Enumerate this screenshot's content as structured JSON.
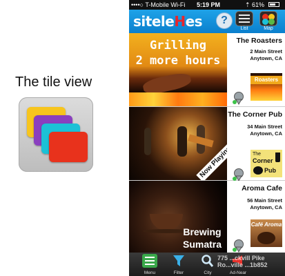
{
  "left_panel": {
    "title": "The tile view"
  },
  "status_bar": {
    "carrier": "••••○ T-Mobile Wi-Fi",
    "time": "5:19 PM",
    "battery": "61%"
  },
  "nav": {
    "logo_start": "site",
    "logo_mid": "le",
    "logo_mid2": "H",
    "logo_end": "es",
    "help_label": "?",
    "list_label": "List",
    "map_label": "Map"
  },
  "tiles": [
    {
      "name": "The Roasters",
      "address1": "2 Main Street",
      "address2": "Anytown, CA",
      "photo_text_line1": "Grilling",
      "photo_text_line2": "2 more hours",
      "thumb_text": "Roasters"
    },
    {
      "name": "The Corner Pub",
      "address1": "34 Main Street",
      "address2": "Anytown, CA",
      "photo_badge": "Now Playing!",
      "thumb_text_line1": "The",
      "thumb_text_line2": "Corner",
      "thumb_text_line3": "Pub"
    },
    {
      "name": "Aroma Cafe",
      "address1": "56 Main Street",
      "address2": "Anytown, CA",
      "photo_text_line1": "Brewing",
      "photo_text_line2": "Sumatra",
      "thumb_text": "Café Aroma"
    }
  ],
  "tab_bar": {
    "tabs": [
      "Menu",
      "Filter",
      "City",
      "Ad-Near"
    ],
    "overlay_text": "775 ...ckvill Pike Ro...ville ...1b852"
  },
  "colors": {
    "nav_blue": "#1a8fd8",
    "logo_red": "#e8262c",
    "tab_bar": "#2a2a2a"
  }
}
